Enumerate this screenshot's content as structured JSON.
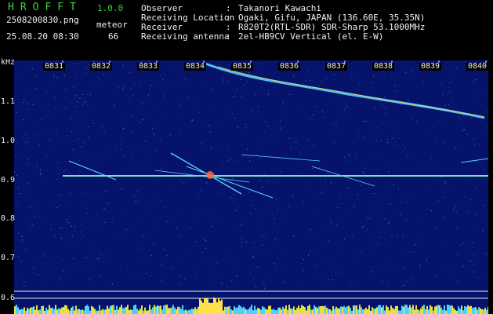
{
  "header": {
    "app_title": "HROFFT",
    "version": "1.0.0",
    "filename": "2508200830.png",
    "datetime": "25.08.20 08:30",
    "meteor_label": "meteor",
    "meteor_count": "66"
  },
  "metadata": [
    {
      "key": "Observer",
      "sep": ":",
      "value": "Takanori Kawachi"
    },
    {
      "key": "Receiving Location",
      "sep": ":",
      "value": "Ogaki, Gifu, JAPAN (136.60E, 35.35N)"
    },
    {
      "key": "Receiver",
      "sep": ":",
      "value": "R820T2(RTL-SDR) SDR-Sharp 53.1000MHz"
    },
    {
      "key": "Receiving antenna",
      "sep": ":",
      "value": "2el-HB9CV Vertical (el. E-W)"
    }
  ],
  "axes": {
    "y_unit": "kHz",
    "y_ticks": [
      "1.1",
      "1.0",
      "0.9",
      "0.8",
      "0.7",
      "0.6"
    ],
    "x_ticks": [
      "0831",
      "0832",
      "0833",
      "0834",
      "0835",
      "0836",
      "0837",
      "0838",
      "0839",
      "0840"
    ]
  },
  "colors": {
    "background": "#000000",
    "spectrogram_bg": "#06136b",
    "title_green": "#33d633",
    "text": "#f0f0f0",
    "signal_cyan": "#5ad0ff",
    "signal_yellow": "#ffe04a"
  }
}
